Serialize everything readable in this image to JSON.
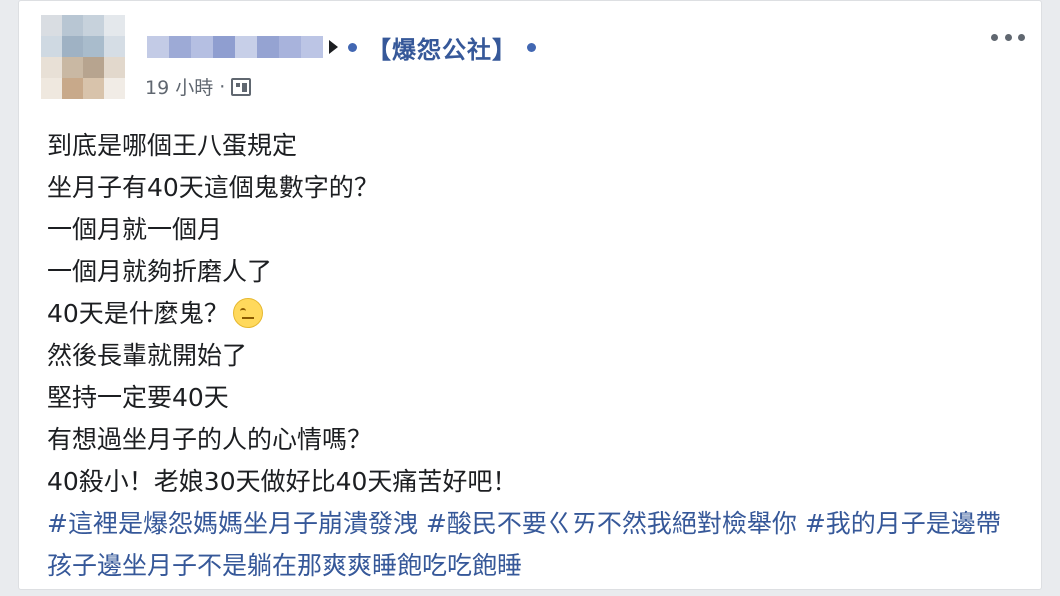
{
  "post": {
    "group_name": "【爆怨公社】",
    "time": "19 小時",
    "separator": "·",
    "body_lines": [
      "到底是哪個王八蛋規定",
      "坐月子有40天這個鬼數字的？",
      "一個月就一個月",
      "一個月就夠折磨人了",
      "40天是什麼鬼？",
      "然後長輩就開始了",
      "堅持一定要40天",
      "有想過坐月子的人的心情嗎？",
      "40殺小！老娘30天做好比40天痛苦好吧！"
    ],
    "hashtags": [
      "#這裡是爆怨媽媽坐月子崩潰發洩",
      "#酸民不要ㄍㄞ不然我絕對檢舉你",
      "#我的月子是邊帶孩子邊坐月子不是躺在那爽爽睡飽吃吃飽睡"
    ]
  },
  "icons": {
    "arrow": "caret-right-icon",
    "privacy": "group-privacy-icon",
    "more": "more-options-icon",
    "emoji": "eye-roll-emoji-icon"
  },
  "colors": {
    "link": "#365899",
    "text": "#1c1e21",
    "meta": "#606770",
    "background": "#e9ebee"
  }
}
